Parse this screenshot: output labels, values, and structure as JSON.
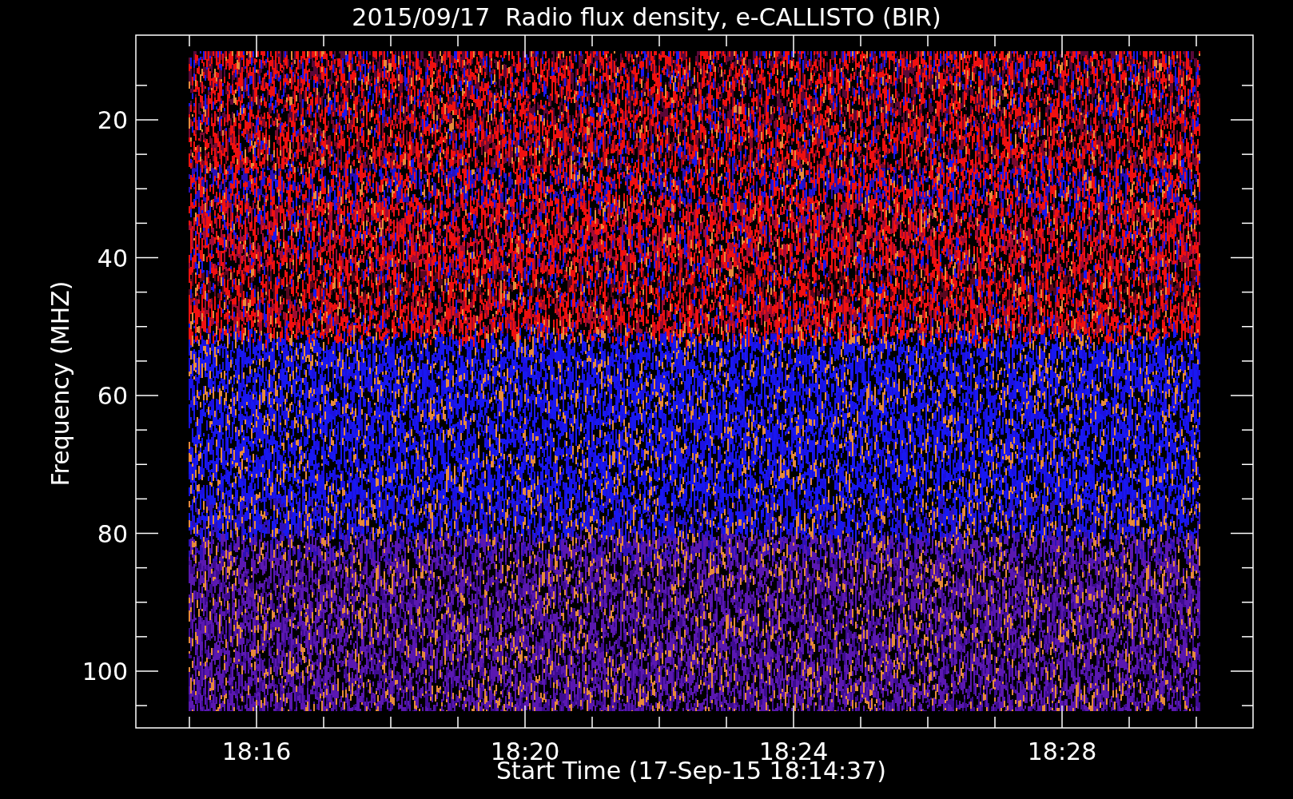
{
  "title": "2015/09/17  Radio flux density, e-CALLISTO (BIR)",
  "y_axis": {
    "label": "Frequency (MHZ)",
    "ticks": [
      "20",
      "40",
      "60",
      "80",
      "100"
    ]
  },
  "x_axis": {
    "label": "Start Time (17-Sep-15 18:14:37)",
    "ticks": [
      "18:16",
      "18:20",
      "18:24",
      "18:28"
    ]
  }
}
